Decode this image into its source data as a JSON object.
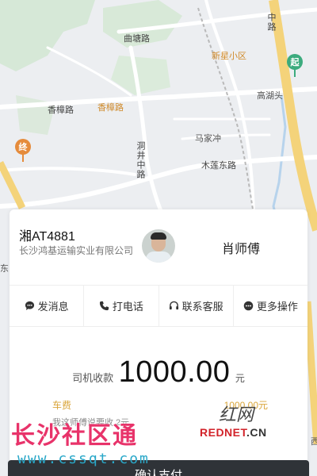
{
  "map": {
    "labels": {
      "qutang_road": "曲塘路",
      "xinxing": "新星小区",
      "gaohu": "高湖头",
      "xiangzhang_road": "香樟路",
      "xiangzhang_road_2": "香樟路",
      "majiachong": "马家冲",
      "dongjing_road": "洞井中路",
      "mulian_road": "木莲东路",
      "zhong_road": "中路",
      "east_edge": "东",
      "west_edge": "西"
    },
    "origin_pin": "起",
    "dest_pin": "终",
    "colors": {
      "origin": "#3cab7e",
      "dest": "#e58b3b",
      "main_road": "#f4d37a"
    }
  },
  "driver": {
    "plate": "湘AT4881",
    "company": "长沙鸿基运输实业有限公司",
    "name": "肖师傅"
  },
  "actions": [
    {
      "label": "发消息",
      "icon": "chat-icon"
    },
    {
      "label": "打电话",
      "icon": "phone-icon"
    },
    {
      "label": "联系客服",
      "icon": "headset-icon"
    },
    {
      "label": "更多操作",
      "icon": "more-icon"
    }
  ],
  "fee": {
    "label": "司机收款",
    "amount": "1000.00",
    "unit": "元"
  },
  "fare": {
    "label": "车费",
    "value": "1000.00元",
    "detail": "我这师傅说要收  2元"
  },
  "primary_button": "确认支付",
  "watermark": {
    "title": "长沙社区通",
    "url": "www.cssqt.com",
    "brand_cn": "红网",
    "brand_en": "REDNET",
    "brand_suffix": ".CN"
  }
}
